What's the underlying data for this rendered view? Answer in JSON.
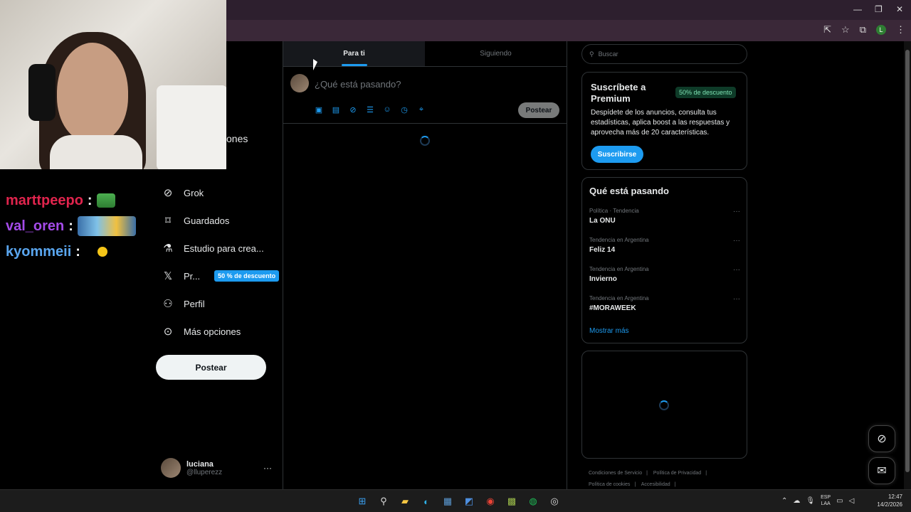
{
  "browser": {
    "window_controls": [
      "—",
      "❐",
      "✕"
    ]
  },
  "chat": {
    "messages": [
      {
        "user": "marttpeepo",
        "color": "#e0244d"
      },
      {
        "user": "val_oren",
        "color": "#a44be8"
      },
      {
        "user": "kyommeii",
        "color": "#5aa6ef"
      }
    ],
    "colon": ":"
  },
  "sidebar": {
    "partial_label": "ones",
    "items": [
      {
        "label": "Grok",
        "icon": "grok-icon"
      },
      {
        "label": "Guardados",
        "icon": "bookmark-icon"
      },
      {
        "label": "Estudio para crea...",
        "icon": "creator-studio-icon"
      },
      {
        "label": "Pr...",
        "icon": "x-premium-icon",
        "badge": "50 % de descuento"
      },
      {
        "label": "Perfil",
        "icon": "profile-icon"
      },
      {
        "label": "Más opciones",
        "icon": "more-options-icon"
      }
    ],
    "post_button": "Postear",
    "account": {
      "name": "luciana",
      "handle": "@lluperezz",
      "more": "···"
    }
  },
  "main": {
    "tabs": [
      {
        "label": "Para ti",
        "active": true
      },
      {
        "label": "Siguiendo",
        "active": false
      }
    ],
    "composer": {
      "placeholder": "¿Qué está pasando?",
      "post_button": "Postear"
    }
  },
  "right": {
    "search_placeholder": "Buscar",
    "premium": {
      "title": "Suscríbete a Premium",
      "discount": "50% de descuento",
      "description": "Despídete de los anuncios, consulta tus estadísticas, aplica boost a las respuestas y aprovecha más de 20 características.",
      "button": "Suscribirse"
    },
    "trends": {
      "title": "Qué está pasando",
      "items": [
        {
          "context": "Política · Tendencia",
          "name": "La ONU"
        },
        {
          "context": "Tendencia en Argentina",
          "name": "Feliz 14"
        },
        {
          "context": "Tendencia en Argentina",
          "name": "Invierno"
        },
        {
          "context": "Tendencia en Argentina",
          "name": "#MORAWEEK"
        }
      ],
      "more_icon": "···",
      "show_more": "Mostrar más"
    },
    "footer": {
      "links": [
        "Condiciones de Servicio",
        "|",
        "Política de Privacidad",
        "|",
        "Política de cookies",
        "|",
        "Accesibilidad",
        "|"
      ]
    }
  },
  "taskbar": {
    "lang_line1": "ESP",
    "lang_line2": "LAA",
    "time": "12:47",
    "date": "14/2/2026"
  },
  "colors": {
    "accent": "#1d9bf0",
    "background": "#000000",
    "border": "#2f3336"
  }
}
